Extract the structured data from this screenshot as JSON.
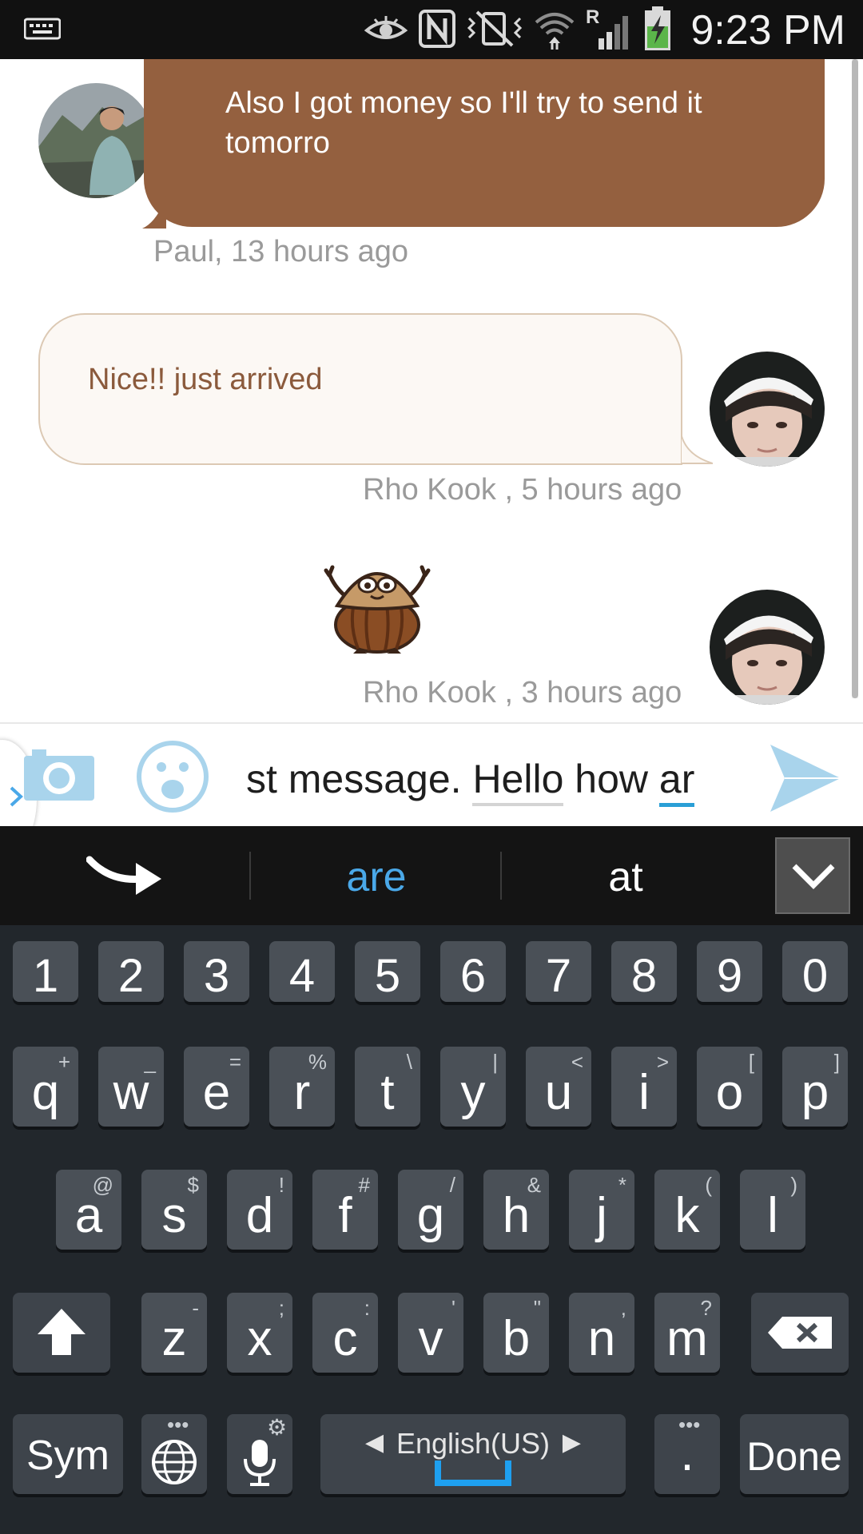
{
  "status_bar": {
    "time": "9:23 PM",
    "icons": [
      "keyboard-icon",
      "eye-icon",
      "nfc-icon",
      "vibrate-mute-icon",
      "wifi-icon",
      "roaming-signal-icon",
      "battery-charging-icon"
    ],
    "roaming_letter": "R"
  },
  "messages": [
    {
      "sender": "Paul",
      "text": "Also I got money so I'll try to send it tomorro",
      "meta": "Paul, 13 hours ago",
      "direction": "incoming"
    },
    {
      "sender": "Rho Kook",
      "text": "Nice!! just arrived",
      "meta": "Rho Kook , 5 hours ago",
      "direction": "outgoing"
    },
    {
      "sender": "Rho Kook",
      "sticker": "acorn-sticker",
      "meta": "Rho Kook , 3 hours ago",
      "direction": "outgoing"
    }
  ],
  "composer": {
    "text_prefix": "st message. ",
    "word_underlined": "Hello",
    "text_mid": " how ",
    "word_composing": "ar"
  },
  "suggestions": {
    "items": [
      "are",
      "at"
    ],
    "highlight_color": "#4aa8e8"
  },
  "keyboard": {
    "numbers": [
      "1",
      "2",
      "3",
      "4",
      "5",
      "6",
      "7",
      "8",
      "9",
      "0"
    ],
    "row1": [
      {
        "k": "q",
        "s": "+"
      },
      {
        "k": "w",
        "s": "_"
      },
      {
        "k": "e",
        "s": "="
      },
      {
        "k": "r",
        "s": "%"
      },
      {
        "k": "t",
        "s": "\\"
      },
      {
        "k": "y",
        "s": "|"
      },
      {
        "k": "u",
        "s": "<"
      },
      {
        "k": "i",
        "s": ">"
      },
      {
        "k": "o",
        "s": "["
      },
      {
        "k": "p",
        "s": "]"
      }
    ],
    "row2": [
      {
        "k": "a",
        "s": "@"
      },
      {
        "k": "s",
        "s": "$"
      },
      {
        "k": "d",
        "s": "!"
      },
      {
        "k": "f",
        "s": "#"
      },
      {
        "k": "g",
        "s": "/"
      },
      {
        "k": "h",
        "s": "&"
      },
      {
        "k": "j",
        "s": "*"
      },
      {
        "k": "k",
        "s": "("
      },
      {
        "k": "l",
        "s": ")"
      }
    ],
    "row3": [
      {
        "k": "z",
        "s": "-"
      },
      {
        "k": "x",
        "s": ";"
      },
      {
        "k": "c",
        "s": ":"
      },
      {
        "k": "v",
        "s": "'"
      },
      {
        "k": "b",
        "s": "\""
      },
      {
        "k": "n",
        "s": ","
      },
      {
        "k": "m",
        "s": "?"
      }
    ],
    "sym_label": "Sym",
    "language_label": "English(US)",
    "period_label": ".",
    "done_label": "Done"
  }
}
